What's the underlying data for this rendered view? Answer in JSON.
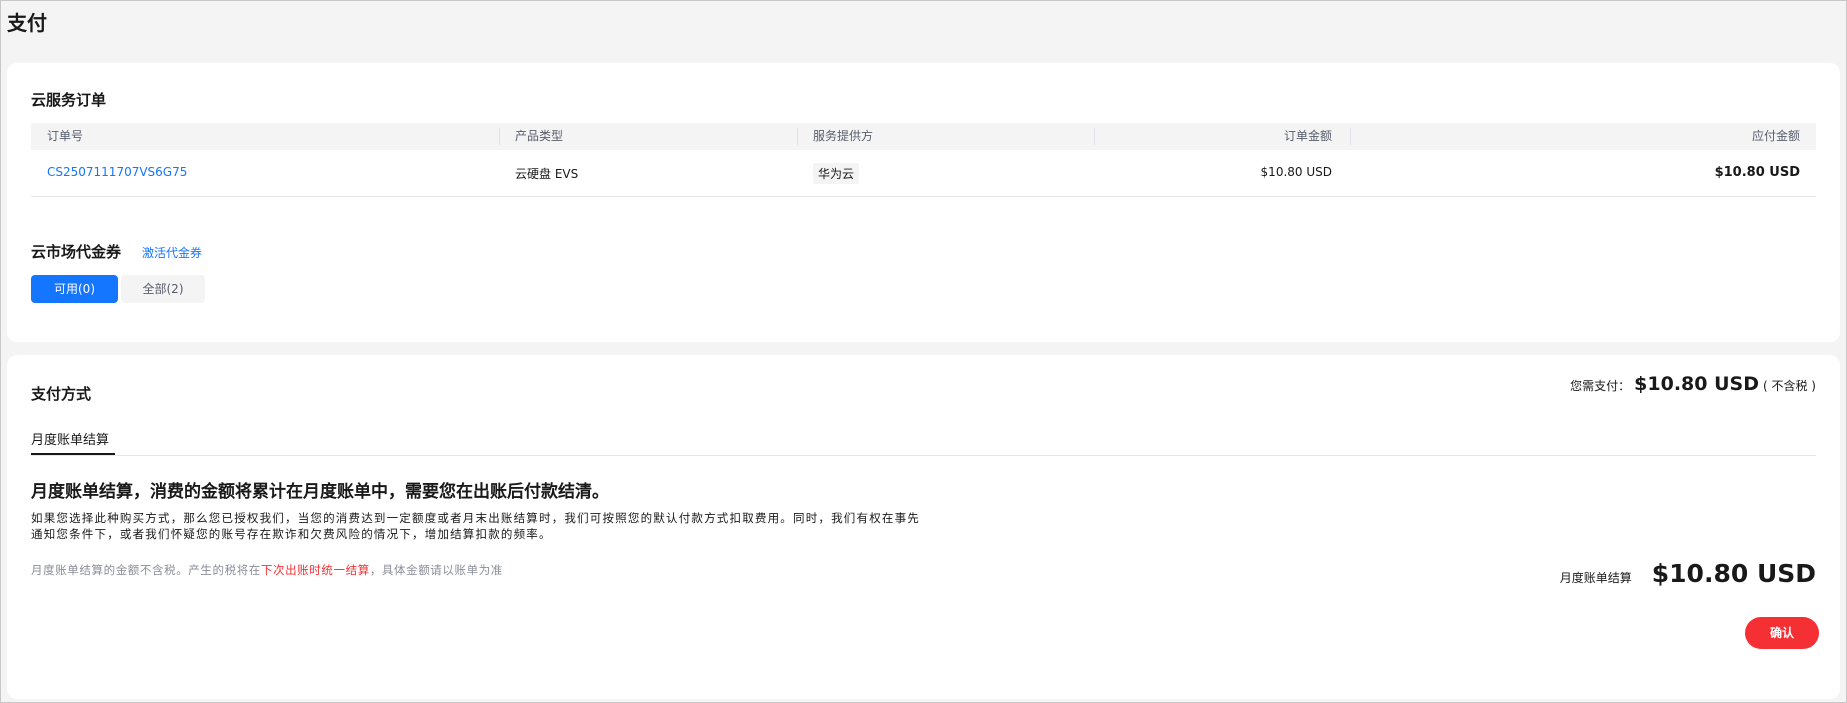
{
  "page_title": "支付",
  "order": {
    "title": "云服务订单",
    "columns": [
      "订单号",
      "产品类型",
      "服务提供方",
      "订单金额",
      "应付金额"
    ],
    "row": {
      "order_no": "CS2507111707VS6G75",
      "product": "云硬盘 EVS",
      "provider": "华为云",
      "amount": "$10.80 USD",
      "payable": "$10.80 USD"
    }
  },
  "coupon": {
    "title": "云市场代金券",
    "activate": "激活代金券",
    "tabs": [
      "可用(0)",
      "全部(2)"
    ]
  },
  "payment": {
    "title": "支付方式",
    "need_pay_label": "您需支付：",
    "need_pay_amount": "$10.80 USD",
    "tax_note": "( 不含税 )",
    "tab": "月度账单结算",
    "headline": "月度账单结算，消费的金额将累计在月度账单中，需要您在出账后付款结清。",
    "desc1": "如果您选择此种购买方式，那么您已授权我们，当您的消费达到一定额度或者月末出账结算时，我们可按照您的默认付款方式扣取费用。同时，我们有权在事先",
    "desc2": "通知您条件下，或者我们怀疑您的账号存在欺诈和欠费风险的情况下，增加结算扣款的频率。",
    "note_a": "月度账单结算的金额不含税。产生的税将在",
    "note_b": "下次出账时统一结算",
    "note_c": "，具体金额请以账单为准",
    "summary_label": "月度账单结算",
    "summary_amount": "$10.80 USD",
    "confirm": "确认"
  },
  "colors": {
    "primary": "#1476ff",
    "danger": "#f53035"
  }
}
